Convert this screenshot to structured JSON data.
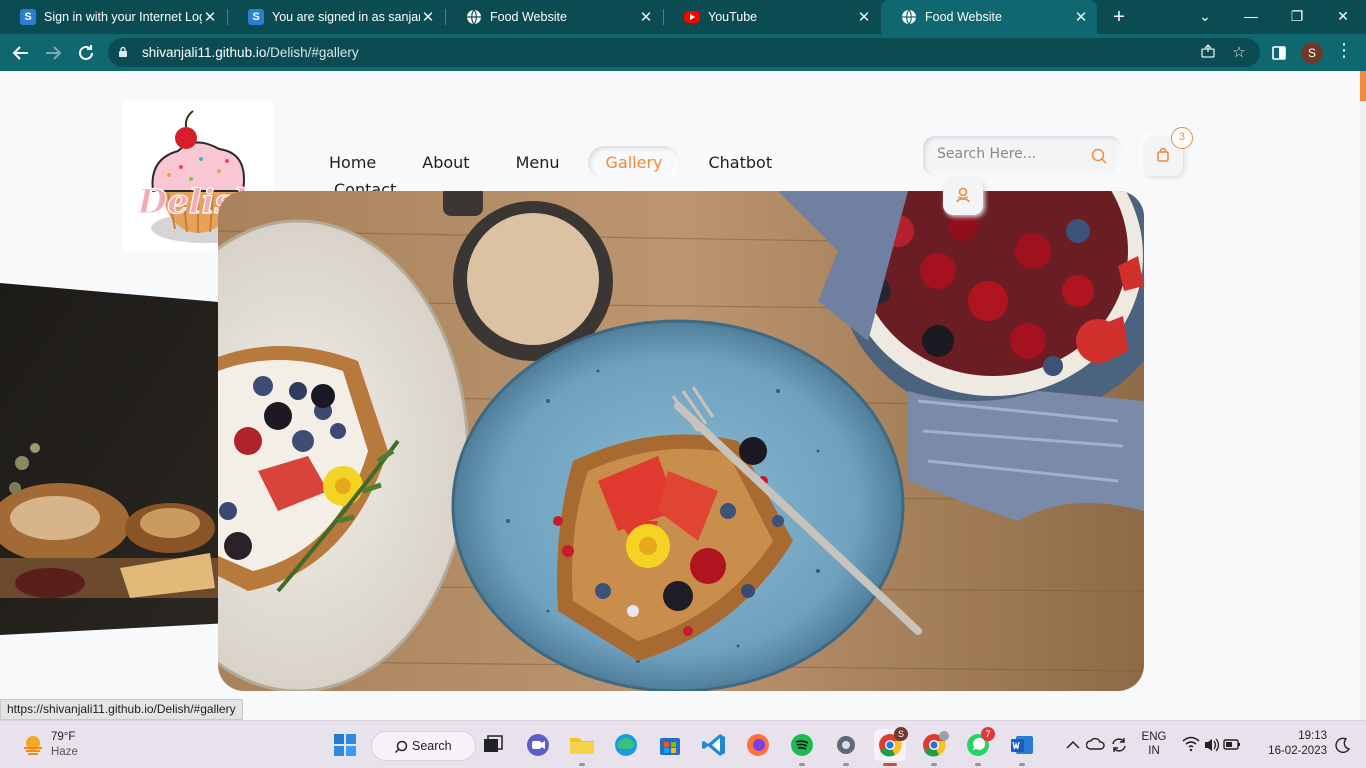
{
  "browser": {
    "tabs": [
      {
        "title": "Sign in with your Internet Log",
        "favicon": "s-brand-icon",
        "active": false
      },
      {
        "title": "You are signed in as sanjana.",
        "favicon": "s-brand-icon",
        "active": false
      },
      {
        "title": "Food Website",
        "favicon": "globe-icon",
        "active": false
      },
      {
        "title": "YouTube",
        "favicon": "youtube-icon",
        "active": false
      },
      {
        "title": "Food Website",
        "favicon": "globe-icon",
        "active": true
      }
    ],
    "url_host": "shivanjali11.github.io",
    "url_path": "/Delish/#gallery",
    "profile_initial": "S",
    "status_url": "https://shivanjali11.github.io/Delish/#gallery"
  },
  "site": {
    "logo_text": "Delish",
    "nav": [
      {
        "label": "Home",
        "active": false
      },
      {
        "label": "About",
        "active": false
      },
      {
        "label": "Menu",
        "active": false
      },
      {
        "label": "Gallery",
        "active": true
      },
      {
        "label": "Chatbot",
        "active": false
      }
    ],
    "nav_contact": "Contact",
    "search_placeholder": "Search Here...",
    "cart_count": "3",
    "accent_color": "#f18a3c"
  },
  "taskbar": {
    "weather_temp": "79°F",
    "weather_cond": "Haze",
    "search_label": "Search",
    "lang_primary": "ENG",
    "lang_secondary": "IN",
    "time": "19:13",
    "date": "16-02-2023",
    "chrome_badge": "S",
    "whatsapp_badge": "7"
  }
}
